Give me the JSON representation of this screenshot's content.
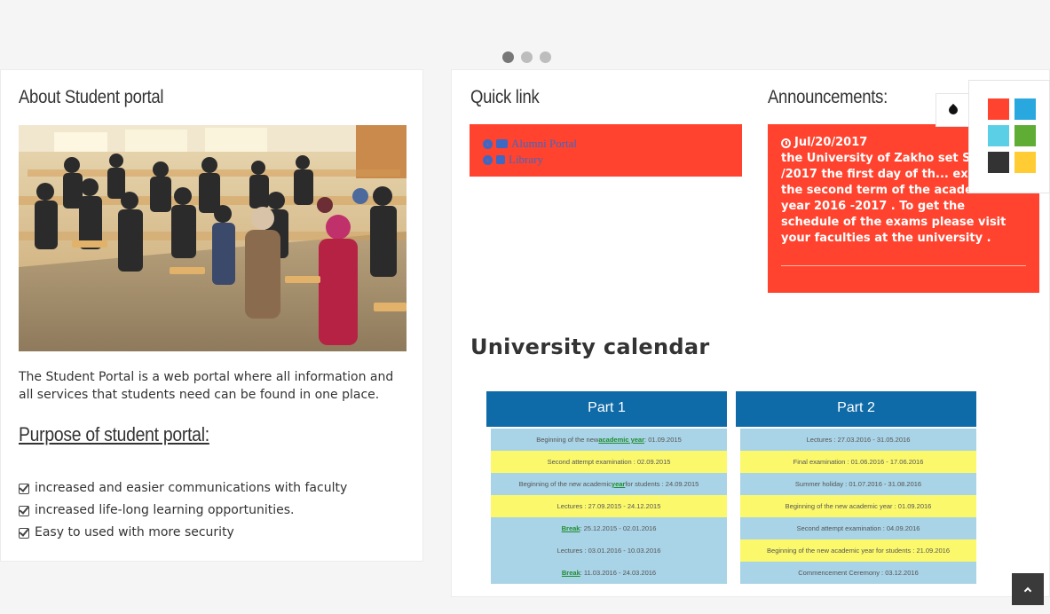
{
  "slider": {
    "dots": 3,
    "active_index": 0
  },
  "about": {
    "title": "About Student portal",
    "description": "The Student Portal is a web portal where all information and all services that students need can be found in one place.",
    "purpose_title": "Purpose of student portal:",
    "purposes": [
      " increased and easier communications with faculty",
      "increased life-long learning opportunities.",
      "Easy to used with more security"
    ]
  },
  "quick_links": {
    "title": "Quick link",
    "items": [
      {
        "label": "Alumni Portal",
        "icon": "graduation-cap-icon"
      },
      {
        "label": "Library",
        "icon": "book-icon"
      }
    ]
  },
  "announcements": {
    "title": "Announcements:",
    "date": "Jul/20/2017",
    "text": "the University of Zakho set S... 9 /9 /2017 the first day of th... exams for the second term of the academic year 2016 -2017 . To get the schedule of the exams please visit your faculties at the university ."
  },
  "calendar": {
    "title": "University calendar",
    "parts": [
      {
        "header": "Part 1",
        "rows": [
          {
            "pre": "Beginning of the new ",
            "hl": "academic year",
            "post": " : 01.09.2015",
            "color": "blue"
          },
          {
            "pre": "Second attempt examination : 02.09.2015",
            "hl": "",
            "post": "",
            "color": "yellow"
          },
          {
            "pre": "Beginning of the new academic ",
            "hl": "year",
            "post": " for students : 24.09.2015",
            "color": "blue"
          },
          {
            "pre": "Lectures : 27.09.2015 - 24.12.2015",
            "hl": "",
            "post": "",
            "color": "yellow"
          },
          {
            "pre": "",
            "hl": "Break",
            "post": " : 25.12.2015 - 02.01.2016",
            "color": "blue"
          },
          {
            "pre": "Lectures : 03.01.2016 - 10.03.2016",
            "hl": "",
            "post": "",
            "color": "blue"
          },
          {
            "pre": "",
            "hl": "Break",
            "post": " : 11.03.2016 - 24.03.2016",
            "color": "blue"
          }
        ]
      },
      {
        "header": "Part 2",
        "rows": [
          {
            "pre": "Lectures : 27.03.2016 - 31.05.2016",
            "hl": "",
            "post": "",
            "color": "blue"
          },
          {
            "pre": "Final examination : 01.06.2016 - 17.06.2016",
            "hl": "",
            "post": "",
            "color": "yellow"
          },
          {
            "pre": "Summer holiday : 01.07.2016 - 31.08.2016",
            "hl": "",
            "post": "",
            "color": "blue"
          },
          {
            "pre": "Beginning of the new academic year : 01.09.2016",
            "hl": "",
            "post": "",
            "color": "yellow"
          },
          {
            "pre": "Second attempt examination : 04.09.2016",
            "hl": "",
            "post": "",
            "color": "blue"
          },
          {
            "pre": "Beginning of the new academic year for students : 21.09.2016",
            "hl": "",
            "post": "",
            "color": "yellow"
          },
          {
            "pre": "Commencement Ceremony : 03.12.2016",
            "hl": "",
            "post": "",
            "color": "blue"
          }
        ]
      }
    ]
  },
  "theme": {
    "toggle_icon": "droplet-icon",
    "swatches": [
      "#ff432e",
      "#29a8e0",
      "#5bcfe6",
      "#5fad35",
      "#333333",
      "#ffcd33"
    ]
  },
  "scroll_top_icon": "chevron-up-icon"
}
